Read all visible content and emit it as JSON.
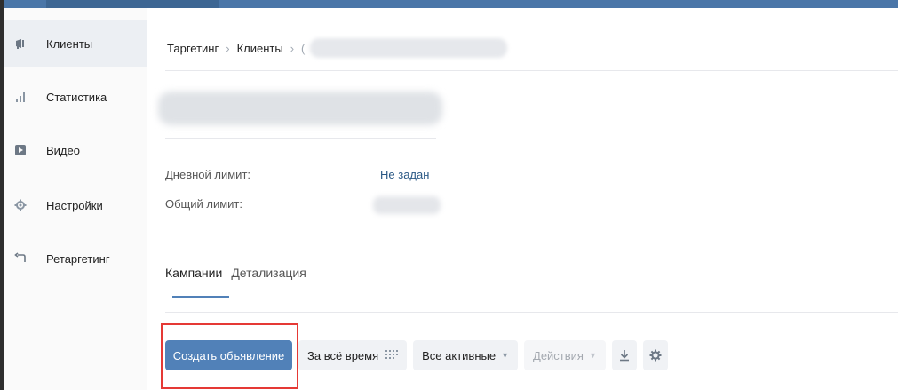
{
  "sidebar": {
    "items": [
      {
        "label": "Клиенты",
        "icon": "megaphone-icon",
        "active": true
      },
      {
        "label": "Статистика",
        "icon": "bar-chart-icon",
        "active": false
      },
      {
        "label": "Видео",
        "icon": "play-icon",
        "active": false
      },
      {
        "label": "Настройки",
        "icon": "gear-icon",
        "active": false
      },
      {
        "label": "Ретаргетинг",
        "icon": "return-arrow-icon",
        "active": false
      }
    ]
  },
  "breadcrumb": {
    "items": [
      "Таргетинг",
      "Клиенты",
      "("
    ]
  },
  "limits": {
    "daily_label": "Дневной лимит:",
    "daily_value": "Не задан",
    "total_label": "Общий лимит:"
  },
  "tabs": [
    {
      "label": "Кампании",
      "active": true
    },
    {
      "label": "Детализация",
      "active": false
    }
  ],
  "toolbar": {
    "create_label": "Создать объявление",
    "period_label": "За всё время",
    "status_label": "Все активные",
    "actions_label": "Действия"
  },
  "colors": {
    "accent": "#5181b8",
    "link": "#2a5885",
    "header": "#4a76a8",
    "highlight": "#e53935"
  }
}
